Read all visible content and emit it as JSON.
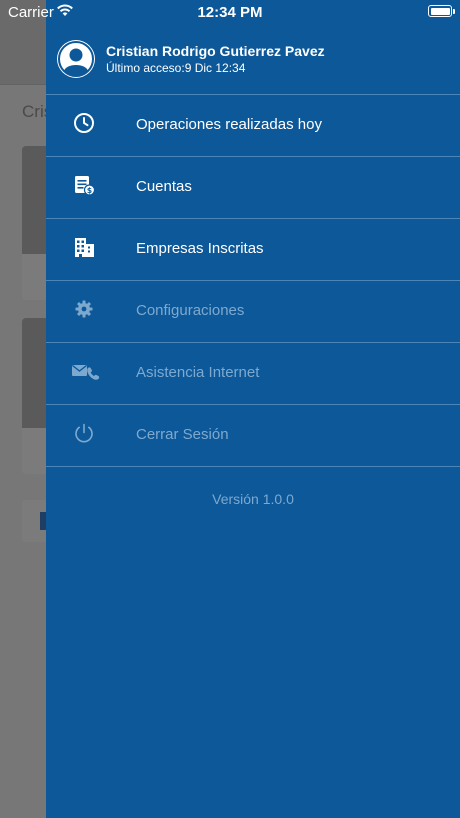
{
  "status_bar": {
    "carrier": "Carrier",
    "time": "12:34 PM"
  },
  "background": {
    "title": "Cris"
  },
  "profile": {
    "name": "Cristian Rodrigo Gutierrez Pavez",
    "last_access": "Último acceso:9 Dic 12:34"
  },
  "menu": [
    {
      "label": "Operaciones realizadas hoy",
      "icon": "clock-icon",
      "enabled": true
    },
    {
      "label": "Cuentas",
      "icon": "document-money-icon",
      "enabled": true
    },
    {
      "label": "Empresas Inscritas",
      "icon": "building-icon",
      "enabled": true
    },
    {
      "label": "Configuraciones",
      "icon": "gear-icon",
      "enabled": false
    },
    {
      "label": "Asistencia Internet",
      "icon": "phone-mail-icon",
      "enabled": false
    },
    {
      "label": "Cerrar Sesión",
      "icon": "power-icon",
      "enabled": false
    }
  ],
  "version": "Versión 1.0.0",
  "colors": {
    "drawer": "#0c5899",
    "divider": "#4c86b9",
    "disabled_text": "#7ea9cf"
  }
}
